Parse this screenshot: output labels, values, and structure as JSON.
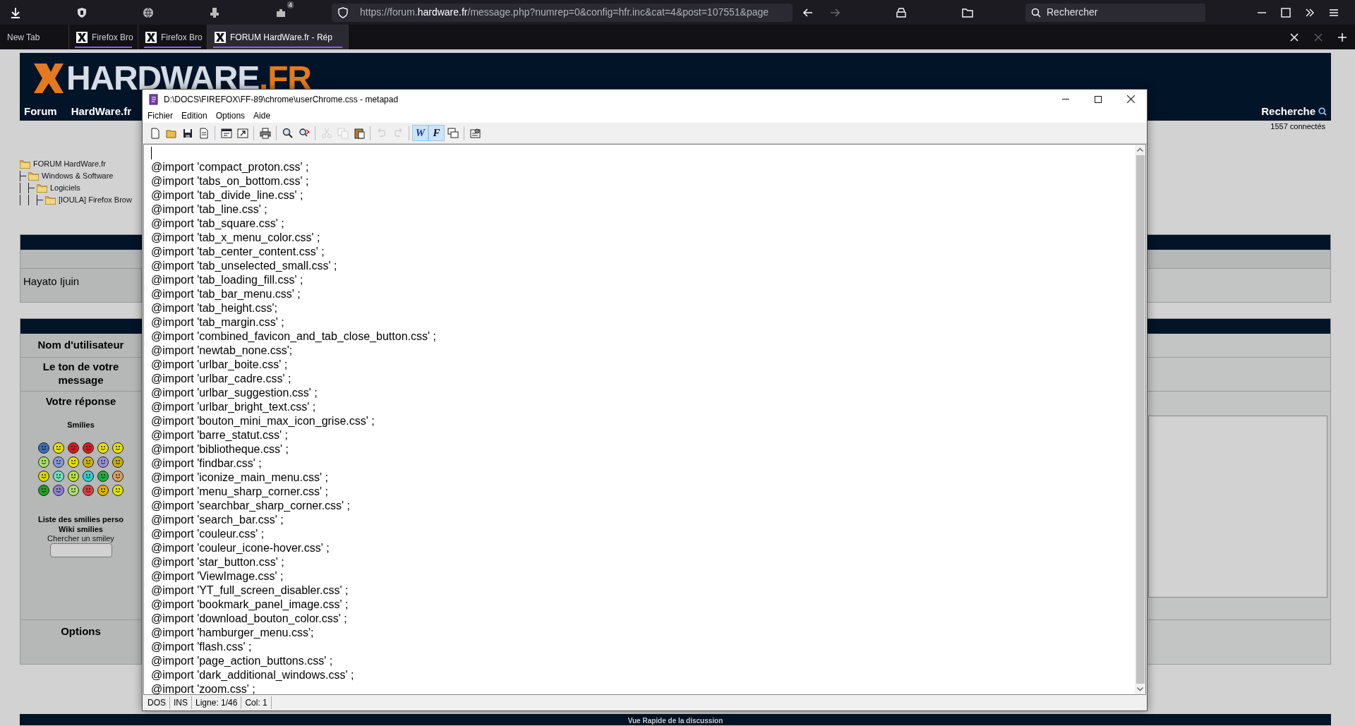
{
  "browser": {
    "extensions": [
      {
        "kind": "download"
      },
      {
        "kind": "shield"
      },
      {
        "kind": "globe"
      },
      {
        "kind": "stamp"
      },
      {
        "kind": "counter",
        "badge": "4"
      }
    ],
    "url": {
      "prefix": "https://forum.",
      "domain": "hardware.fr",
      "path": "/message.php?numrep=0&config=hfr.inc&cat=4&post=107551&page"
    },
    "nav_buttons": [
      {
        "kind": "back",
        "disabled": false
      },
      {
        "kind": "forward",
        "disabled": true
      }
    ],
    "actions": [
      {
        "kind": "library"
      },
      {
        "kind": "folder"
      }
    ],
    "search": {
      "placeholder": "Rechercher"
    },
    "window_controls": [
      {
        "kind": "minimize"
      },
      {
        "kind": "maximize"
      },
      {
        "kind": "overflow"
      },
      {
        "kind": "menu"
      }
    ],
    "tabs": [
      {
        "label": "New Tab",
        "selected": false,
        "favicon": false,
        "underlined": false
      },
      {
        "label": "Firefox Bro",
        "selected": false,
        "favicon": true,
        "underlined": true
      },
      {
        "label": "Firefox Bro",
        "selected": false,
        "favicon": true,
        "underlined": true
      },
      {
        "label": "FORUM HardWare.fr - Rép",
        "selected": true,
        "favicon": true,
        "underlined": true
      }
    ],
    "tab_controls": [
      {
        "kind": "close",
        "disabled": false
      },
      {
        "kind": "close",
        "disabled": true
      },
      {
        "kind": "new-tab",
        "disabled": false
      }
    ]
  },
  "forum": {
    "logo": {
      "main": "HARDWARE",
      "suffix": ".FR"
    },
    "nav": [
      "Forum",
      "HardWare.fr"
    ],
    "search_link": "Recherche",
    "online_count": "1557 connectés",
    "breadcrumb": [
      {
        "label": "FORUM HardWare.fr",
        "children": [
          {
            "label": "Windows & Software",
            "children": [
              {
                "label": "Logiciels",
                "children": [
                  {
                    "label": "[IOULA] Firefox Brow"
                  }
                ]
              }
            ]
          }
        ]
      }
    ],
    "author": "Hayato Ijuin",
    "form": {
      "username_label": "Nom d'utilisateur",
      "tone_label": "Le ton de votre message",
      "reply_label": "Votre réponse",
      "smilies_title": "Smilies",
      "smilies_links": [
        "Liste des smilies perso",
        "Wiki smilies"
      ],
      "smiley_search_label": "Chercher un smiley",
      "options_label": "Options"
    },
    "footer": "Vue Rapide de la discussion"
  },
  "editor": {
    "title": "D:\\DOCS\\FIREFOX\\FF-89\\chrome\\userChrome.css - metapad",
    "menu": [
      "Fichier",
      "Edition",
      "Options",
      "Aide"
    ],
    "toolbar": [
      [
        {
          "kind": "new",
          "disabled": false,
          "pressed": false
        },
        {
          "kind": "open",
          "disabled": false,
          "pressed": false
        },
        {
          "kind": "save",
          "disabled": false,
          "pressed": false
        },
        {
          "kind": "page",
          "disabled": false,
          "pressed": false
        }
      ],
      [
        {
          "kind": "preview",
          "disabled": false,
          "pressed": false
        },
        {
          "kind": "export",
          "disabled": false,
          "pressed": false
        }
      ],
      [
        {
          "kind": "print",
          "disabled": false,
          "pressed": false
        }
      ],
      [
        {
          "kind": "find",
          "disabled": false,
          "pressed": false
        },
        {
          "kind": "replace",
          "disabled": false,
          "pressed": false
        }
      ],
      [
        {
          "kind": "cut",
          "disabled": true,
          "pressed": false
        },
        {
          "kind": "copy",
          "disabled": true,
          "pressed": false
        },
        {
          "kind": "paste",
          "disabled": false,
          "pressed": false
        }
      ],
      [
        {
          "kind": "undo",
          "disabled": true,
          "pressed": false
        },
        {
          "kind": "redo",
          "disabled": true,
          "pressed": false
        }
      ],
      [
        {
          "kind": "wrap",
          "label": "W",
          "disabled": false,
          "pressed": true
        },
        {
          "kind": "font",
          "label": "F",
          "disabled": false,
          "pressed": true
        },
        {
          "kind": "window",
          "disabled": false,
          "pressed": false
        }
      ],
      [
        {
          "kind": "settings",
          "disabled": false,
          "pressed": false
        }
      ]
    ],
    "lines": [
      "@import 'compact_proton.css' ;",
      "@import 'tabs_on_bottom.css' ;",
      "@import 'tab_divide_line.css' ;",
      "@import 'tab_line.css' ;",
      "@import 'tab_square.css' ;",
      "@import 'tab_x_menu_color.css' ;",
      "@import 'tab_center_content.css' ;",
      "@import 'tab_unselected_small.css' ;",
      "@import 'tab_loading_fill.css' ;",
      "@import 'tab_bar_menu.css' ;",
      "@import 'tab_height.css';",
      "@import 'tab_margin.css' ;",
      "@import 'combined_favicon_and_tab_close_button.css' ;",
      "@import 'newtab_none.css';",
      "@import 'urlbar_boite.css' ;",
      "@import 'urlbar_cadre.css' ;",
      "@import 'urlbar_suggestion.css' ;",
      "@import 'urlbar_bright_text.css' ;",
      "@import 'bouton_mini_max_icon_grise.css' ;",
      "@import 'barre_statut.css' ;",
      "@import 'bibliotheque.css' ;",
      "@import 'findbar.css' ;",
      "@import 'iconize_main_menu.css' ;",
      "@import 'menu_sharp_corner.css' ;",
      "@import 'searchbar_sharp_corner.css' ;",
      "@import 'search_bar.css' ;",
      "@import 'couleur.css' ;",
      "@import 'couleur_icone-hover.css' ;",
      "@import 'star_button.css' ;",
      "@import 'ViewImage.css' ;",
      "@import 'YT_full_screen_disabler.css' ;",
      "@import 'bookmark_panel_image.css' ;",
      "@import 'download_bouton_color.css' ;",
      "@import 'hamburger_menu.css';",
      "@import 'flash.css' ;",
      "@import 'page_action_buttons.css' ;",
      "@import 'dark_additional_windows.css' ;",
      "@import 'zoom.css' ;"
    ],
    "status": [
      "DOS",
      "INS",
      "Ligne: 1/46",
      "Col: 1"
    ]
  }
}
